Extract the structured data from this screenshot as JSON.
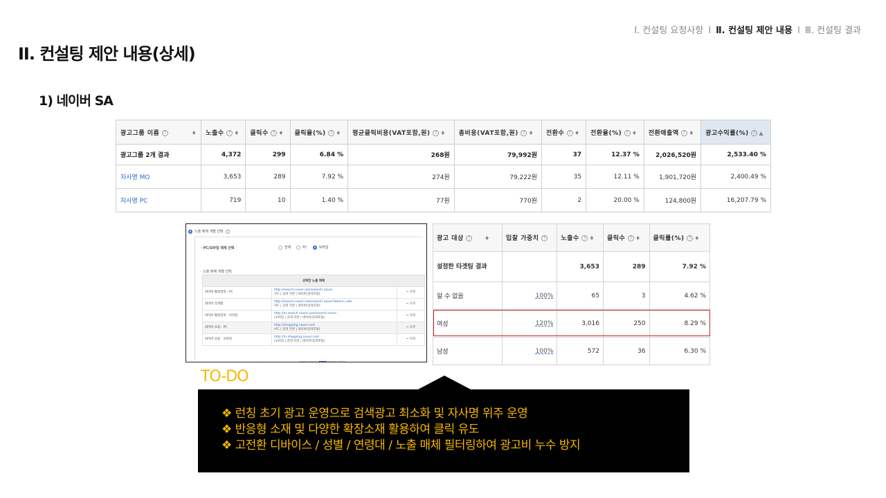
{
  "nav": {
    "item1": "Ⅰ. 컨설팅 요청사항",
    "item2": "Ⅱ. 컨설팅 제안 내용",
    "item3": "Ⅲ. 컨설팅 결과",
    "separator": "l"
  },
  "page_title": "II. 컨설팅 제안 내용(상세)",
  "sub_title": "1) 네이버 SA",
  "main_table": {
    "headers": [
      "광고그룹 이름",
      "노출수",
      "클릭수",
      "클릭율(%)",
      "평균클릭비용(VAT포함,원)",
      "총비용(VAT포함,원)",
      "전환수",
      "전환율(%)",
      "전환매출액",
      "광고수익률(%)"
    ],
    "rows": [
      [
        "광고그룹 2개 결과",
        "4,372",
        "299",
        "6.84 %",
        "268원",
        "79,992원",
        "37",
        "12.37 %",
        "2,026,520원",
        "2,533.40 %"
      ],
      [
        "자사명 MO",
        "3,653",
        "289",
        "7.92 %",
        "274원",
        "79,222원",
        "35",
        "12.11 %",
        "1,901,720원",
        "2,400.49 %"
      ],
      [
        "자사명 PC",
        "719",
        "10",
        "1.40 %",
        "77원",
        "770원",
        "2",
        "20.00 %",
        "124,800원",
        "16,207.79 %"
      ]
    ]
  },
  "media_panel": {
    "title": "노출 매체 개별 선택",
    "pc_mobile_label": "PC/모바일 매체 선택",
    "radio_all": "전체",
    "radio_pc": "PC",
    "radio_mobile": "모바일",
    "individual_label": "노출 매체 개별 선택",
    "table_header": "선택한 노출 매체",
    "rows": [
      {
        "name": "네이버 통합검색 - PC",
        "url": "http://search.naver.com/search.naver",
        "desc": "(PC | 검색 지면 | 네이버/검색포털)",
        "action": "삭제"
      },
      {
        "name": "네이버 검색탭",
        "url": "http://search.naver.com/search.naver?where=site",
        "desc": "(PC | 검색 지면 | 네이버/검색포털)",
        "action": "삭제"
      },
      {
        "name": "네이버 통합검색 - 모바일",
        "url": "http://m.search.naver.com/search.naver",
        "desc": "(모바일 | 검색 지면 | 네이버/검색포털)",
        "action": "삭제"
      },
      {
        "name": "네이버 쇼핑 - PC",
        "url": "http://shopping.naver.com",
        "desc": "(PC | 검색 지면 | 네이버/검색포털)",
        "action": "삭제"
      },
      {
        "name": "네이버 쇼핑 - 모바일",
        "url": "http://m.shopping.naver.com",
        "desc": "(모바일 | 검색 지면 | 네이버/검색포털)",
        "action": "삭제"
      }
    ],
    "pager": [
      "«",
      "‹",
      "1",
      "›",
      "»"
    ]
  },
  "target_table": {
    "headers": [
      "광고 대상",
      "입찰 가중치",
      "노출수",
      "클릭수",
      "클릭률(%)"
    ],
    "rows": [
      [
        "설정한 타겟팅 결과",
        "",
        "3,653",
        "289",
        "7.92 %"
      ],
      [
        "알 수 없음",
        "100%",
        "65",
        "3",
        "4.62 %"
      ],
      [
        "여성",
        "120%",
        "3,016",
        "250",
        "8.29 %"
      ],
      [
        "남성",
        "100%",
        "572",
        "36",
        "6.30 %"
      ]
    ]
  },
  "todo_label": "TO-DO",
  "callout": {
    "bullet": "❖",
    "lines": [
      "런칭 초기 광고 운영으로 검색광고 최소화 및 자사명 위주 운영",
      "반응형 소재 및 다양한 확장소재 활용하여 클릭 유도",
      "고전환 디바이스 / 성별 / 연령대 / 노출 매체 필터링하여 광고비 누수 방지"
    ]
  },
  "colors": {
    "accent_yellow": "#f5b800",
    "link_blue": "#2f6bc4",
    "highlight_red": "#c62828",
    "callout_bg": "#000000"
  }
}
